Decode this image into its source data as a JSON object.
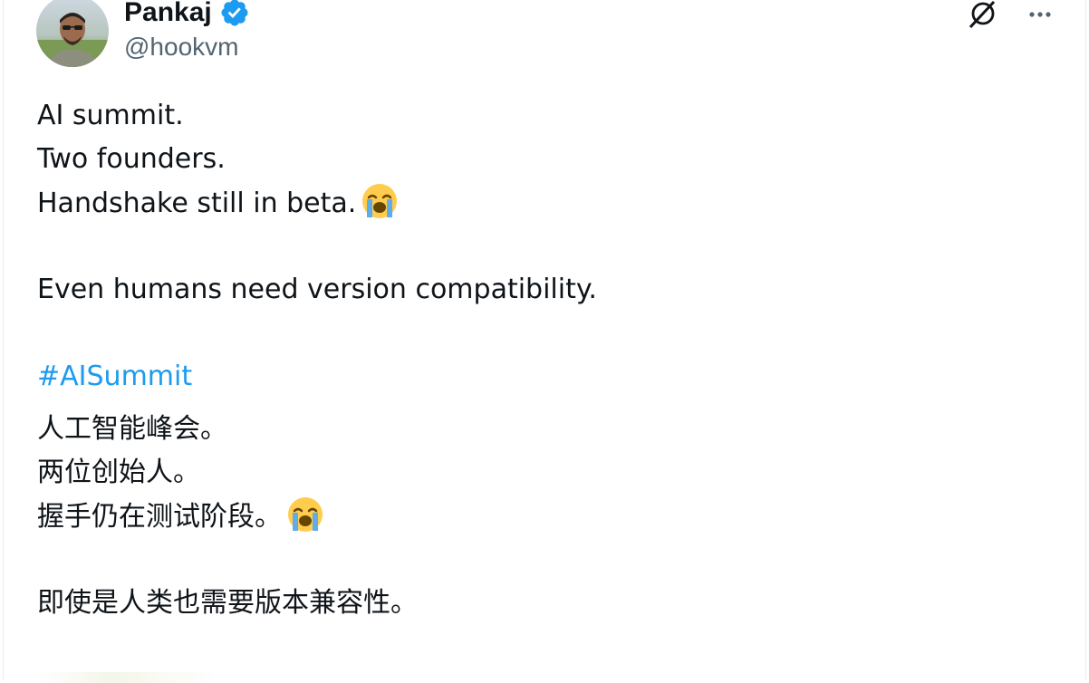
{
  "tweet": {
    "author_name": "Pankaj",
    "author_handle": "@hookvm",
    "verified": true,
    "accent_color": "#1d9bf0",
    "lines_en": [
      "AI summit.",
      "Two founders.",
      "Handshake still in beta."
    ],
    "line_en_4": "Even humans need version compatibility.",
    "hashtag": "#AISummit",
    "lines_zh": [
      "人工智能峰会。",
      "两位创始人。",
      "握手仍在测试阶段。"
    ],
    "line_zh_4": "即使是人类也需要版本兼容性。",
    "emoji": "loudly-crying-face"
  },
  "icons": {
    "grok": "grok-icon",
    "more": "more-options-icon",
    "verified": "verified-badge-icon"
  }
}
